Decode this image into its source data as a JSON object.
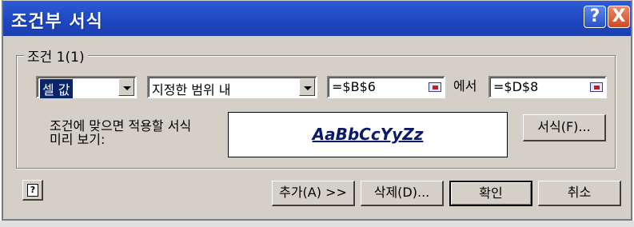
{
  "window": {
    "title": "조건부 서식",
    "help_glyph": "?",
    "close_glyph": "X"
  },
  "condition": {
    "group_label": "조건 1(1)",
    "type_combo": {
      "value": "셀 값"
    },
    "operator_combo": {
      "value": "지정한 범위 내"
    },
    "value1": "=$B$6",
    "between_label": "에서",
    "value2": "=$D$8"
  },
  "preview": {
    "label_line1": "조건에 맞으면 적용할 서식",
    "label_line2": "미리 보기:",
    "sample": "AaBbCcYyZz"
  },
  "buttons": {
    "format": "서식(F)...",
    "add": "추가(A) >>",
    "delete": "삭제(D)...",
    "ok": "확인",
    "cancel": "취소",
    "help_glyph": "?"
  },
  "colors": {
    "titlebar": "#1f47c2",
    "dialog": "#d4d0c8",
    "selection": "#0a246a"
  }
}
